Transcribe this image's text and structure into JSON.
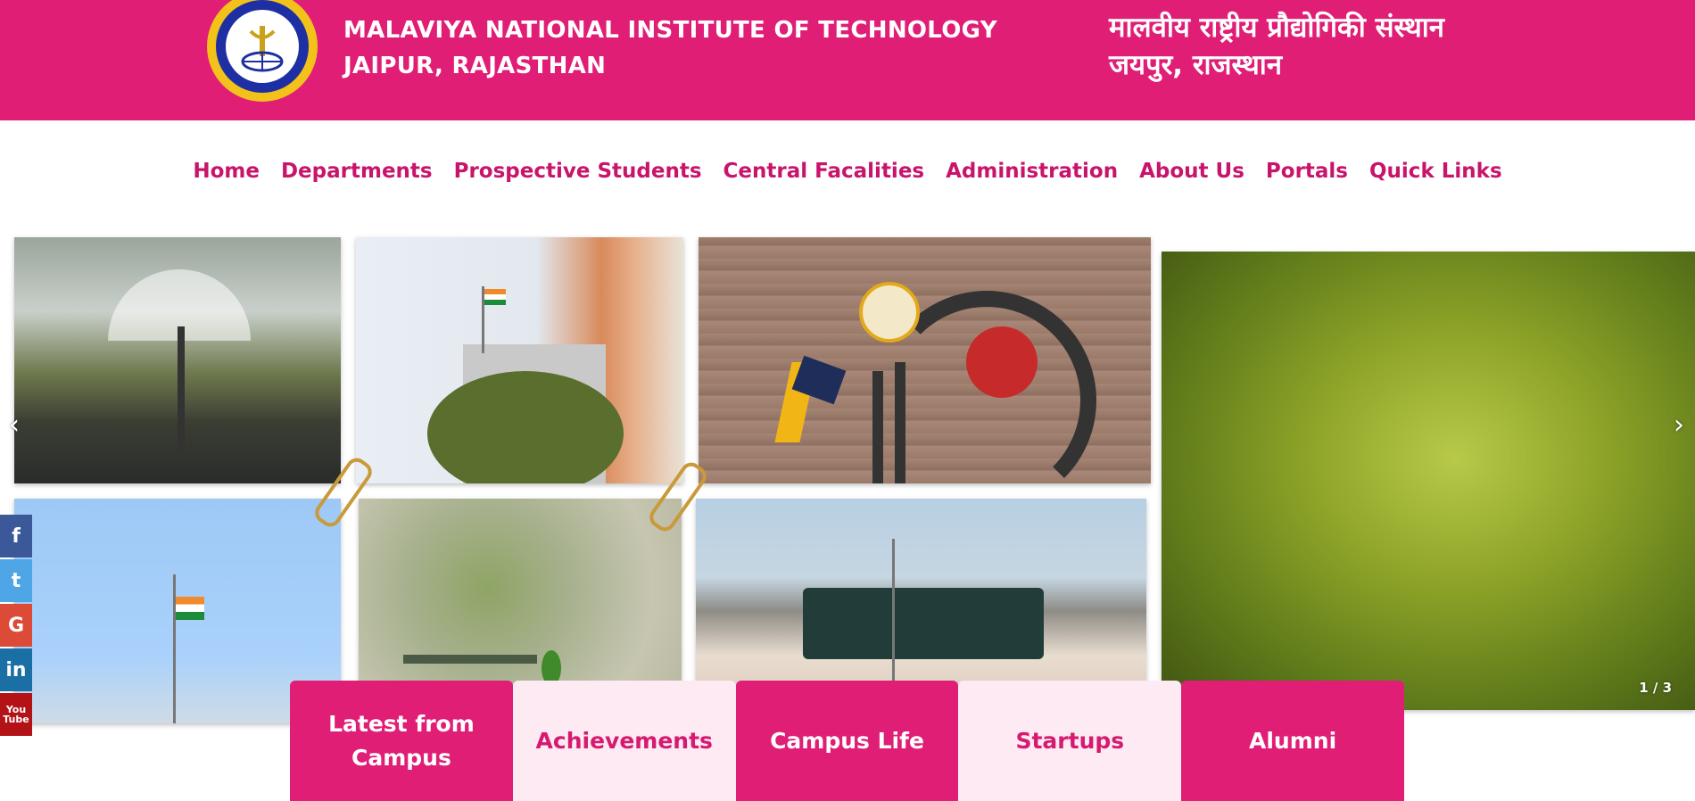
{
  "header": {
    "title_en_line1": "MALAVIYA NATIONAL INSTITUTE OF TECHNOLOGY",
    "title_en_line2": "JAIPUR, RAJASTHAN",
    "title_hi_line1": "मालवीय राष्ट्रीय प्रौद्योगिकी संस्थान",
    "title_hi_line2": "जयपुर, राजस्थान",
    "brand_color": "#e01e76"
  },
  "nav": {
    "items": [
      {
        "label": "Home"
      },
      {
        "label": "Departments"
      },
      {
        "label": "Prospective Students"
      },
      {
        "label": "Central Facalities"
      },
      {
        "label": "Administration"
      },
      {
        "label": "About Us"
      },
      {
        "label": "Portals"
      },
      {
        "label": "Quick Links"
      }
    ]
  },
  "slider": {
    "prev_icon": "‹",
    "next_icon": "›",
    "counter": "1 / 3"
  },
  "social": {
    "facebook": "f",
    "twitter": "t",
    "google": "G",
    "linkedin": "in",
    "youtube": "You Tube"
  },
  "tabs": [
    {
      "label": "Latest from Campus",
      "style": "dark"
    },
    {
      "label": "Achievements",
      "style": "light"
    },
    {
      "label": "Campus Life",
      "style": "dark"
    },
    {
      "label": "Startups",
      "style": "light"
    },
    {
      "label": "Alumni",
      "style": "dark"
    }
  ]
}
